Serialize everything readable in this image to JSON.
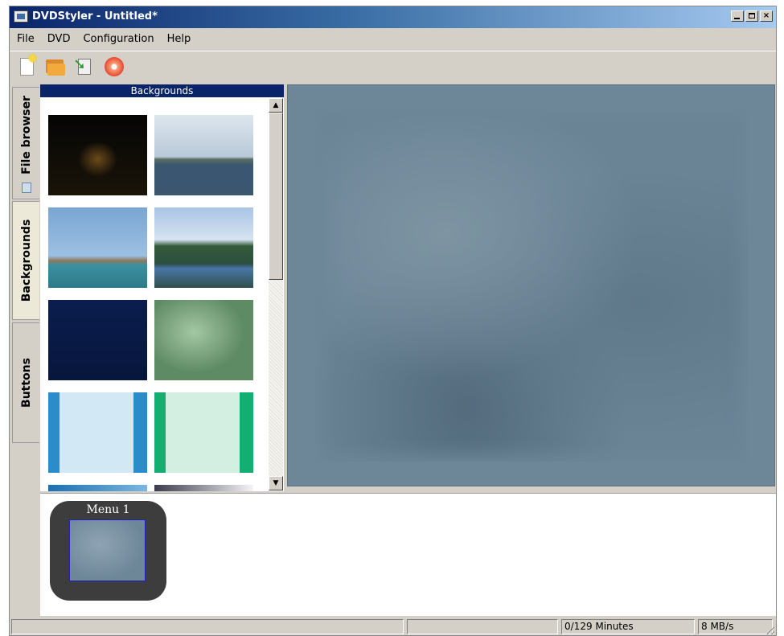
{
  "window": {
    "title": "DVDStyler - Untitled*",
    "controls": {
      "minimize": "_",
      "maximize": "□",
      "close": "×"
    }
  },
  "menu": [
    "File",
    "DVD",
    "Configuration",
    "Help"
  ],
  "toolbar": {
    "buttons": [
      {
        "id": "new",
        "icon": "new-document-icon"
      },
      {
        "id": "open",
        "icon": "open-folder-icon"
      },
      {
        "id": "save",
        "icon": "save-icon"
      },
      {
        "id": "burn",
        "icon": "burn-disc-icon"
      }
    ]
  },
  "side_tabs": {
    "file_browser": "File browser",
    "backgrounds": "Backgrounds",
    "buttons": "Buttons",
    "active": "Backgrounds"
  },
  "panel": {
    "title": "Backgrounds"
  },
  "backgrounds": [
    {
      "name": "night-road",
      "colors": [
        "#050505",
        "#1a1408"
      ]
    },
    {
      "name": "sea-clouds",
      "colors": [
        "#c6d3df",
        "#3c5670"
      ]
    },
    {
      "name": "coast-ship",
      "colors": [
        "#7aa5d3",
        "#2e7a8a"
      ]
    },
    {
      "name": "green-coast",
      "colors": [
        "#a9c4e4",
        "#2f4f4a"
      ]
    },
    {
      "name": "dark-navy",
      "colors": [
        "#0b1d4f",
        "#07163c"
      ]
    },
    {
      "name": "green-blur",
      "colors": [
        "#8db58f",
        "#5e8a64"
      ]
    },
    {
      "name": "light-blue-stripes",
      "colors": [
        "#d3e8f5",
        "#2a8cc8"
      ]
    },
    {
      "name": "light-green-stripes",
      "colors": [
        "#d2efe2",
        "#14ad72"
      ]
    },
    {
      "name": "blue-gradient",
      "colors": [
        "#1a6fb5",
        "#7ab8df"
      ]
    },
    {
      "name": "gray-gradient",
      "colors": [
        "#3b3b4b",
        "#f4f4f8"
      ]
    }
  ],
  "titleset": {
    "menus": [
      {
        "label": "Menu 1"
      }
    ]
  },
  "status": {
    "field1": "",
    "field2": "",
    "duration": "0/129 Minutes",
    "bitrate": "8 MB/s"
  }
}
